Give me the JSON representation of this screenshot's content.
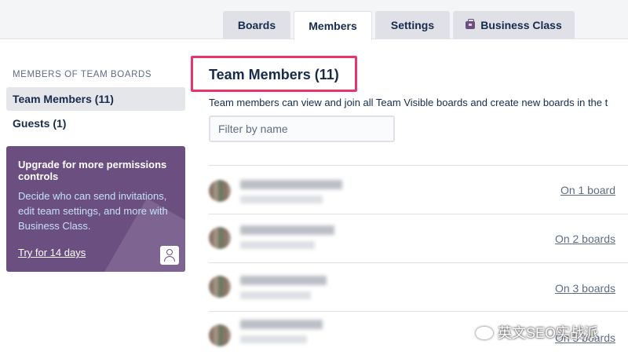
{
  "tabs": [
    {
      "label": "Boards"
    },
    {
      "label": "Members",
      "active": true
    },
    {
      "label": "Settings"
    },
    {
      "label": "Business Class",
      "icon": "briefcase-icon"
    }
  ],
  "sidebar": {
    "heading": "MEMBERS OF TEAM BOARDS",
    "items": [
      {
        "label": "Team Members (11)",
        "active": true
      },
      {
        "label": "Guests (1)"
      }
    ],
    "upgrade": {
      "title": "Upgrade for more permissions controls",
      "description": "Decide who can send invitations, edit team settings, and more with Business Class.",
      "link": "Try for 14 days",
      "icon": "person-icon"
    }
  },
  "main": {
    "title": "Team Members (11)",
    "description": "Team members can view and join all Team Visible boards and create new boards in the t",
    "filter_placeholder": "Filter by name",
    "members": [
      {
        "boards": "On 1 board"
      },
      {
        "boards": "On 2 boards"
      },
      {
        "boards": "On 3 boards"
      },
      {
        "boards": "On 5 boards"
      }
    ]
  },
  "watermark": "英文SEO实战派",
  "colors": {
    "accent_purple": "#6b4f80",
    "highlight": "#e8356b",
    "text": "#172b4d"
  }
}
